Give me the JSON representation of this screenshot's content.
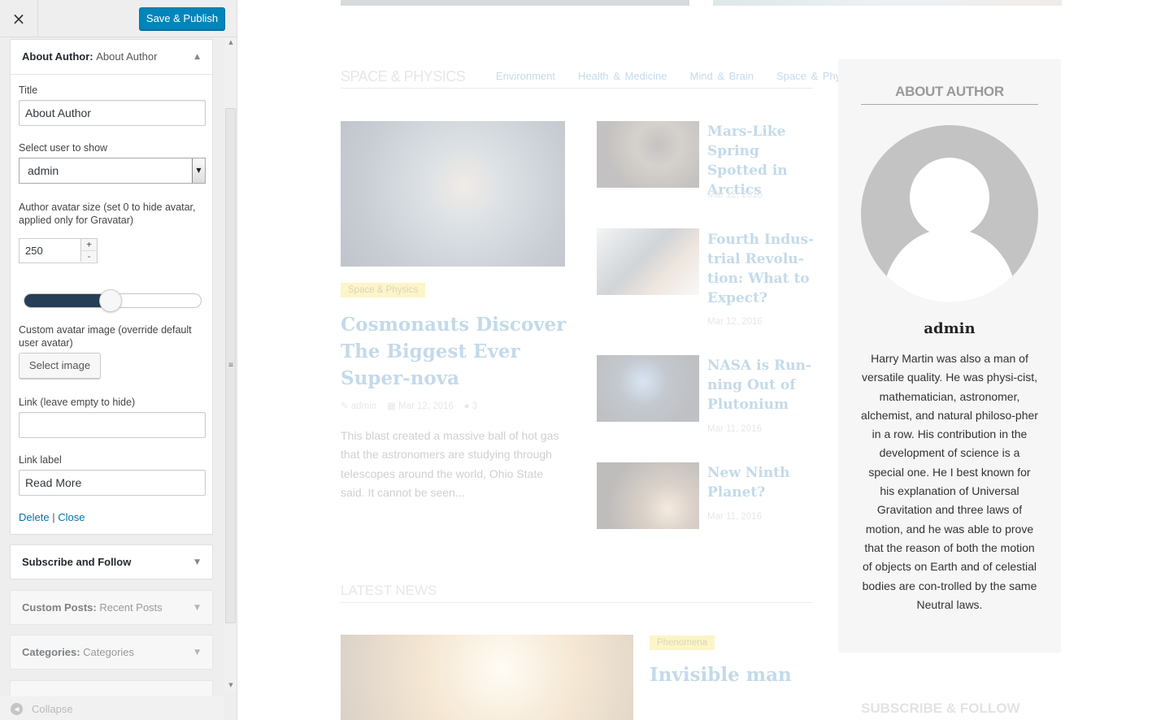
{
  "topbar": {
    "close_icon": "×",
    "save_label": "Save & Publish"
  },
  "widget_author": {
    "head_title": "About Author:",
    "head_sub": "About Author",
    "title_label": "Title",
    "title_value": "About Author",
    "user_label": "Select user to show",
    "user_value": "admin",
    "size_label": "Author avatar size (set 0 to hide avatar, applied only for Gravatar)",
    "size_value": "250",
    "size_fraction": 0.49,
    "custom_label": "Custom avatar image (override default user avatar)",
    "select_image": "Select image",
    "link_label": "Link (leave empty to hide)",
    "link_value": "",
    "linklabel_label": "Link label",
    "linklabel_value": "Read More",
    "delete": "Delete",
    "sep": "|",
    "close": "Close"
  },
  "collapsed_widgets": [
    {
      "title": "Subscribe and Follow",
      "sub": ""
    },
    {
      "title": "Custom Posts:",
      "sub": "Recent Posts"
    },
    {
      "title": "Categories:",
      "sub": "Categories"
    }
  ],
  "collapse_label": "Collapse",
  "preview": {
    "section_title": "SPACE & PHYSICS",
    "tabs": [
      "Environment",
      "Health & Medicine",
      "Mind & Brain",
      "Space & Physics"
    ],
    "main_post": {
      "tag": "Space & Physics",
      "title": "Cosmonauts Discover The Biggest Ever Super-nova",
      "author": "admin",
      "date": "Mar 12, 2016",
      "comments": "3",
      "excerpt": "This blast created a massive ball of hot gas that the astronomers are studying through telescopes around the world, Ohio State said. It cannot be seen..."
    },
    "side_posts": [
      {
        "title": "Mars-Like Spring Spotted in Arctics",
        "date": "Mar 12, 2016"
      },
      {
        "title": "Fourth Indus-trial Revolu-tion: What to Expect?",
        "date": "Mar 12, 2016"
      },
      {
        "title": "NASA is Run-ning Out of Plutonium",
        "date": "Mar 11, 2016"
      },
      {
        "title": "New Ninth Planet?",
        "date": "Mar 11, 2016"
      }
    ],
    "latest_title": "LATEST NEWS",
    "latest_tag": "Phenomena",
    "latest_post_title": "Invisible man",
    "about": {
      "heading": "ABOUT AUTHOR",
      "name": "admin",
      "bio": "Harry Martin was also a man of versatile quality. He was physi-cist, mathematician, astronomer, alchemist, and natural philoso-pher in a row. His contribution in the development of science is a special one. He I best known for his explanation of Universal Gravitation and three laws of motion, and he was able to prove that the reason of both the motion of objects on Earth and of celestial bodies are con-trolled by the same Neutral laws.",
      "next_heading": "SUBSCRIBE & FOLLOW"
    }
  },
  "colors": {
    "accent": "#0085ba",
    "slider_fill": "#253f57",
    "link": "#0073aa",
    "post_title": "#2a7ab5"
  }
}
